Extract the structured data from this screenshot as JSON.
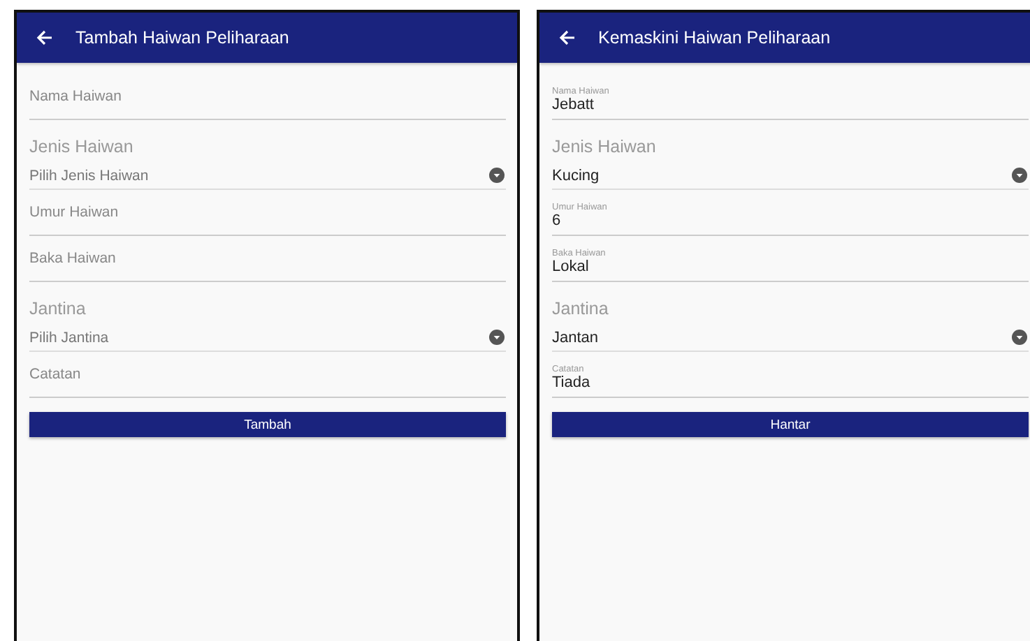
{
  "screens": [
    {
      "title": "Tambah Haiwan Peliharaan",
      "fields": [
        {
          "kind": "text",
          "label": "Nama Haiwan"
        },
        {
          "kind": "select",
          "label": "Jenis Haiwan",
          "placeholder": "Pilih Jenis Haiwan"
        },
        {
          "kind": "text",
          "label": "Umur Haiwan"
        },
        {
          "kind": "text",
          "label": "Baka Haiwan"
        },
        {
          "kind": "select",
          "label": "Jantina",
          "placeholder": "Pilih Jantina"
        },
        {
          "kind": "text",
          "label": "Catatan"
        }
      ],
      "button": "Tambah"
    },
    {
      "title": "Kemaskini Haiwan Peliharaan",
      "fields": [
        {
          "kind": "text",
          "label": "Nama Haiwan",
          "value": "Jebatt"
        },
        {
          "kind": "select",
          "label": "Jenis Haiwan",
          "value": "Kucing"
        },
        {
          "kind": "text",
          "label": "Umur Haiwan",
          "value": "6"
        },
        {
          "kind": "text",
          "label": "Baka Haiwan",
          "value": "Lokal"
        },
        {
          "kind": "select",
          "label": "Jantina",
          "value": "Jantan"
        },
        {
          "kind": "text",
          "label": "Catatan",
          "value": "Tiada"
        }
      ],
      "button": "Hantar"
    }
  ]
}
